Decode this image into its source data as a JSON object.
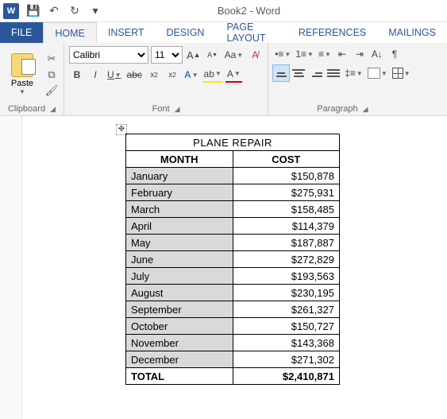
{
  "window": {
    "title": "Book2 - Word"
  },
  "qat": {
    "save": "💾",
    "undo": "↶",
    "redo": "↻",
    "customize": "▾"
  },
  "tabs": {
    "file": "FILE",
    "home": "HOME",
    "insert": "INSERT",
    "design": "DESIGN",
    "page_layout": "PAGE LAYOUT",
    "references": "REFERENCES",
    "mailings": "MAILINGS"
  },
  "ribbon": {
    "clipboard": {
      "label": "Clipboard",
      "paste": "Paste"
    },
    "font": {
      "label": "Font",
      "name": "Calibri",
      "size": "11",
      "bold": "B",
      "italic": "I",
      "underline": "U",
      "strike": "abc",
      "sub": "x",
      "sup": "x",
      "grow_a": "A",
      "grow_a2": "A",
      "shrink_a": "A",
      "case": "Aa",
      "clear": "A"
    },
    "paragraph": {
      "label": "Paragraph",
      "pilcrow": "¶"
    }
  },
  "table": {
    "title": "PLANE REPAIR",
    "col_month": "MONTH",
    "col_cost": "COST",
    "rows": [
      {
        "month": "January",
        "cost": "$150,878"
      },
      {
        "month": "February",
        "cost": "$275,931"
      },
      {
        "month": "March",
        "cost": "$158,485"
      },
      {
        "month": "April",
        "cost": "$114,379"
      },
      {
        "month": "May",
        "cost": "$187,887"
      },
      {
        "month": "June",
        "cost": "$272,829"
      },
      {
        "month": "July",
        "cost": "$193,563"
      },
      {
        "month": "August",
        "cost": "$230,195"
      },
      {
        "month": "September",
        "cost": "$261,327"
      },
      {
        "month": "October",
        "cost": "$150,727"
      },
      {
        "month": "November",
        "cost": "$143,368"
      },
      {
        "month": "December",
        "cost": "$271,302"
      }
    ],
    "total_label": "TOTAL",
    "total_value": "$2,410,871"
  }
}
